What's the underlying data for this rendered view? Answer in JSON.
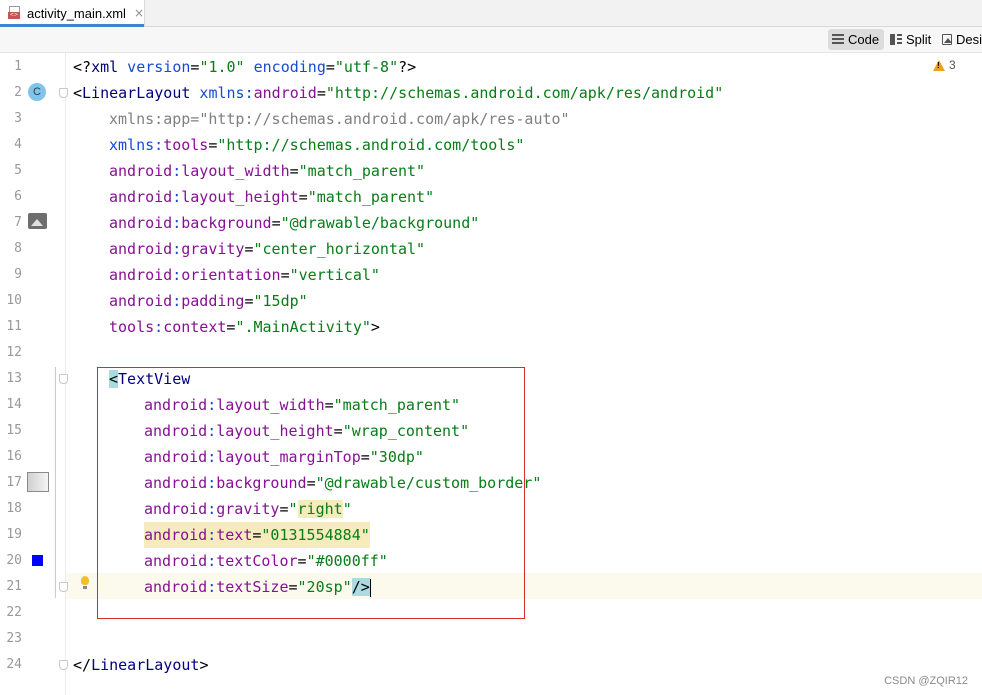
{
  "tab": {
    "filename": "activity_main.xml",
    "close": "×",
    "icon": "xml-file-icon"
  },
  "view_modes": [
    {
      "label": "Code",
      "icon": "code-lines-icon",
      "active": true
    },
    {
      "label": "Split",
      "icon": "split-view-icon",
      "active": false
    },
    {
      "label": "Desi",
      "icon": "design-image-icon",
      "active": false
    }
  ],
  "inspections": {
    "warning_count": "3",
    "icon": "warning-triangle-icon"
  },
  "gutter": {
    "class_badge": "C",
    "textcolor_swatch": "#0000ff",
    "icons": [
      "class-badge-icon",
      "image-preview-icon",
      "drawable-preview-icon",
      "color-swatch-icon",
      "lightbulb-icon"
    ]
  },
  "lines": [
    {
      "n": "1"
    },
    {
      "n": "2"
    },
    {
      "n": "3"
    },
    {
      "n": "4"
    },
    {
      "n": "5"
    },
    {
      "n": "6"
    },
    {
      "n": "7"
    },
    {
      "n": "8"
    },
    {
      "n": "9"
    },
    {
      "n": "10"
    },
    {
      "n": "11"
    },
    {
      "n": "12"
    },
    {
      "n": "13"
    },
    {
      "n": "14"
    },
    {
      "n": "15"
    },
    {
      "n": "16"
    },
    {
      "n": "17"
    },
    {
      "n": "18"
    },
    {
      "n": "19"
    },
    {
      "n": "20"
    },
    {
      "n": "21"
    },
    {
      "n": "22"
    },
    {
      "n": "23"
    },
    {
      "n": "24"
    }
  ],
  "code": {
    "l1": {
      "open": "<?",
      "name": "xml",
      "a1": " version",
      "eq": "=",
      "v1": "\"1.0\"",
      "a2": " encoding",
      "v2": "\"utf-8\"",
      "close": "?>"
    },
    "l2": {
      "open": "<",
      "tag": "LinearLayout",
      "ns": " xmlns",
      "colon": ":",
      "attr": "android",
      "eq": "=",
      "val": "\"http://schemas.android.com/apk/res/android\""
    },
    "l3": {
      "ns": "xmlns",
      "colon": ":",
      "attr": "app",
      "eq": "=",
      "val": "\"http://schemas.android.com/apk/res-auto\""
    },
    "l4": {
      "ns": "xmlns",
      "colon": ":",
      "attr": "tools",
      "eq": "=",
      "val": "\"http://schemas.android.com/tools\""
    },
    "l5": {
      "ns": "android",
      "colon": ":",
      "attr": "layout_width",
      "eq": "=",
      "val": "\"match_parent\""
    },
    "l6": {
      "ns": "android",
      "colon": ":",
      "attr": "layout_height",
      "eq": "=",
      "val": "\"match_parent\""
    },
    "l7": {
      "ns": "android",
      "colon": ":",
      "attr": "background",
      "eq": "=",
      "val": "\"@drawable/background\""
    },
    "l8": {
      "ns": "android",
      "colon": ":",
      "attr": "gravity",
      "eq": "=",
      "val": "\"center_horizontal\""
    },
    "l9": {
      "ns": "android",
      "colon": ":",
      "attr": "orientation",
      "eq": "=",
      "val": "\"vertical\""
    },
    "l10": {
      "ns": "android",
      "colon": ":",
      "attr": "padding",
      "eq": "=",
      "val": "\"15dp\""
    },
    "l11": {
      "ns": "tools",
      "colon": ":",
      "attr": "context",
      "eq": "=",
      "val": "\".MainActivity\"",
      "close": ">"
    },
    "l13": {
      "open": "<",
      "tag": "TextView"
    },
    "l14": {
      "ns": "android",
      "colon": ":",
      "attr": "layout_width",
      "eq": "=",
      "val": "\"match_parent\""
    },
    "l15": {
      "ns": "android",
      "colon": ":",
      "attr": "layout_height",
      "eq": "=",
      "val": "\"wrap_content\""
    },
    "l16": {
      "ns": "android",
      "colon": ":",
      "attr": "layout_marginTop",
      "eq": "=",
      "val": "\"30dp\""
    },
    "l17": {
      "ns": "android",
      "colon": ":",
      "attr": "background",
      "eq": "=",
      "val": "\"@drawable/custom_border\""
    },
    "l18": {
      "ns": "android",
      "colon": ":",
      "attr": "gravity",
      "eq": "=",
      "q1": "\"",
      "valhl": "right",
      "q2": "\""
    },
    "l19": {
      "ns": "android",
      "colon": ":",
      "attr": "text",
      "eq": "=",
      "val": "\"0131554884\""
    },
    "l20": {
      "ns": "android",
      "colon": ":",
      "attr": "textColor",
      "eq": "=",
      "val": "\"#0000ff\""
    },
    "l21": {
      "ns": "android",
      "colon": ":",
      "attr": "textSize",
      "eq": "=",
      "val": "\"20sp\"",
      "close": "/>"
    },
    "l24": {
      "open": "</",
      "tag": "LinearLayout",
      "close": ">"
    }
  },
  "watermark": "CSDN @ZQIR12",
  "colors": {
    "tag": "#000080",
    "attribute": "#871094",
    "value": "#067d17",
    "annotation_box": "#d82c2c",
    "highlight": "#f6ebbc",
    "caret_highlight": "#a9dbe0"
  }
}
